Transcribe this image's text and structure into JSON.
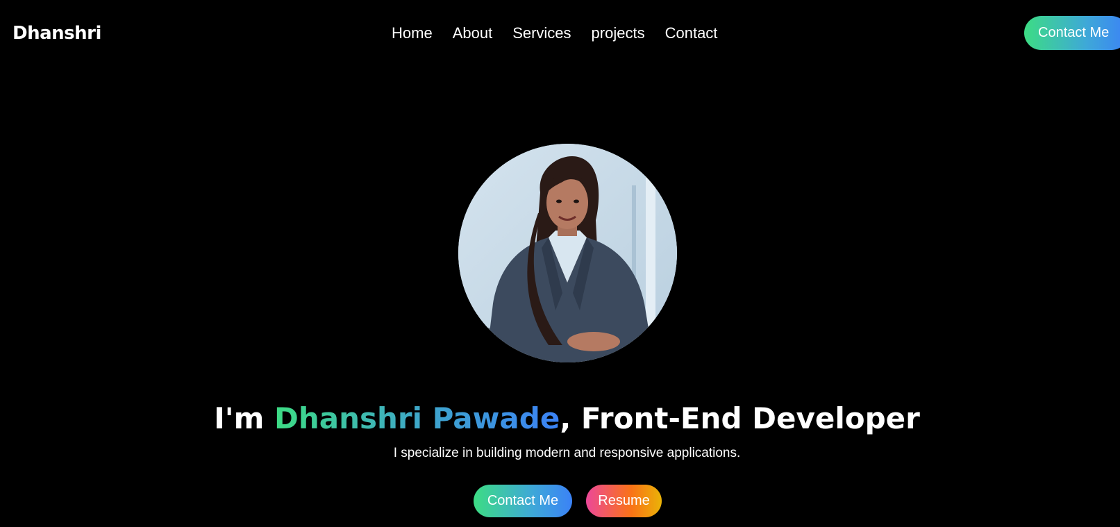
{
  "navbar": {
    "logo": "Dhanshri",
    "links": [
      "Home",
      "About",
      "Services",
      "projects",
      "Contact"
    ],
    "contact_button": "Contact Me"
  },
  "hero": {
    "photo_alt": "profile photo",
    "title_prefix": "I'm ",
    "title_name": "Dhanshri Pawade",
    "title_suffix": ", Front-End Developer",
    "subtitle": "I specialize in building modern and responsive applications.",
    "buttons": {
      "contact": "Contact Me",
      "resume": "Resume"
    }
  },
  "colors": {
    "background": "#000000",
    "green_accent": "#3ddc84",
    "blue_accent": "#3b82f6",
    "pink_accent": "#ec4899",
    "orange_accent": "#f97316"
  }
}
